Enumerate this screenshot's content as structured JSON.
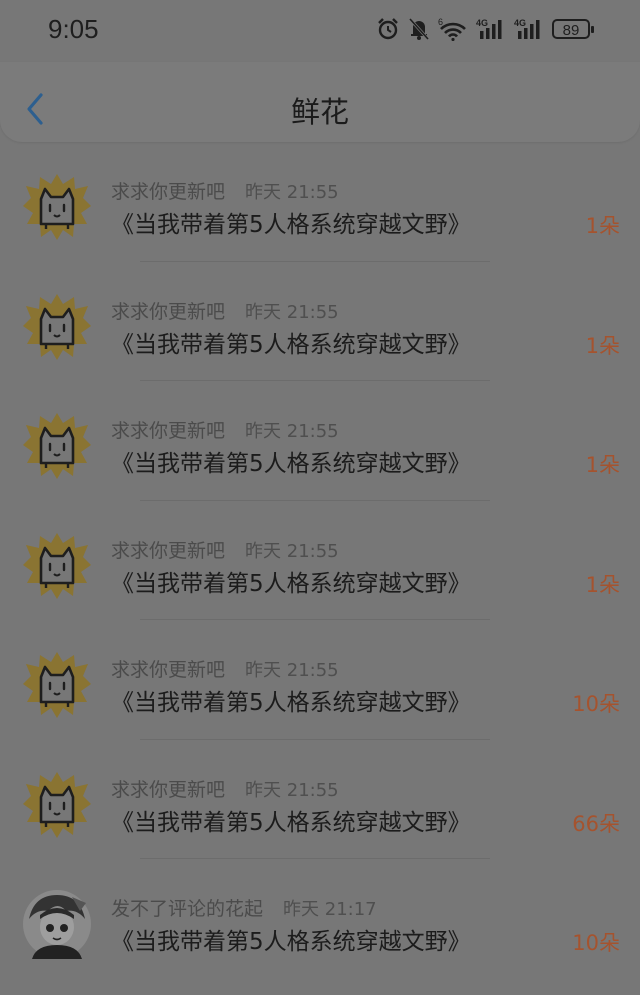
{
  "status_bar": {
    "time": "9:05",
    "battery": "89",
    "signal1": "4G",
    "signal2": "4G",
    "wifi_gen": "6"
  },
  "header": {
    "title": "鲜花"
  },
  "items": [
    {
      "user": "求求你更新吧",
      "time": "昨天 21:55",
      "book": "《当我带着第5人格系统穿越文野》",
      "count": "1朵",
      "avatar": "cat-avatar"
    },
    {
      "user": "求求你更新吧",
      "time": "昨天 21:55",
      "book": "《当我带着第5人格系统穿越文野》",
      "count": "1朵",
      "avatar": "cat-avatar"
    },
    {
      "user": "求求你更新吧",
      "time": "昨天 21:55",
      "book": "《当我带着第5人格系统穿越文野》",
      "count": "1朵",
      "avatar": "cat-avatar"
    },
    {
      "user": "求求你更新吧",
      "time": "昨天 21:55",
      "book": "《当我带着第5人格系统穿越文野》",
      "count": "1朵",
      "avatar": "cat-avatar"
    },
    {
      "user": "求求你更新吧",
      "time": "昨天 21:55",
      "book": "《当我带着第5人格系统穿越文野》",
      "count": "10朵",
      "avatar": "cat-avatar"
    },
    {
      "user": "求求你更新吧",
      "time": "昨天 21:55",
      "book": "《当我带着第5人格系统穿越文野》",
      "count": "66朵",
      "avatar": "cat-avatar"
    },
    {
      "user": "发不了评论的花起",
      "time": "昨天 21:17",
      "book": "《当我带着第5人格系统穿越文野》",
      "count": "10朵",
      "avatar": "anime-avatar"
    }
  ],
  "colors": {
    "accent": "#a5532e",
    "back_arrow": "#2d5f8f",
    "avatar_burst": "#8a7432"
  }
}
